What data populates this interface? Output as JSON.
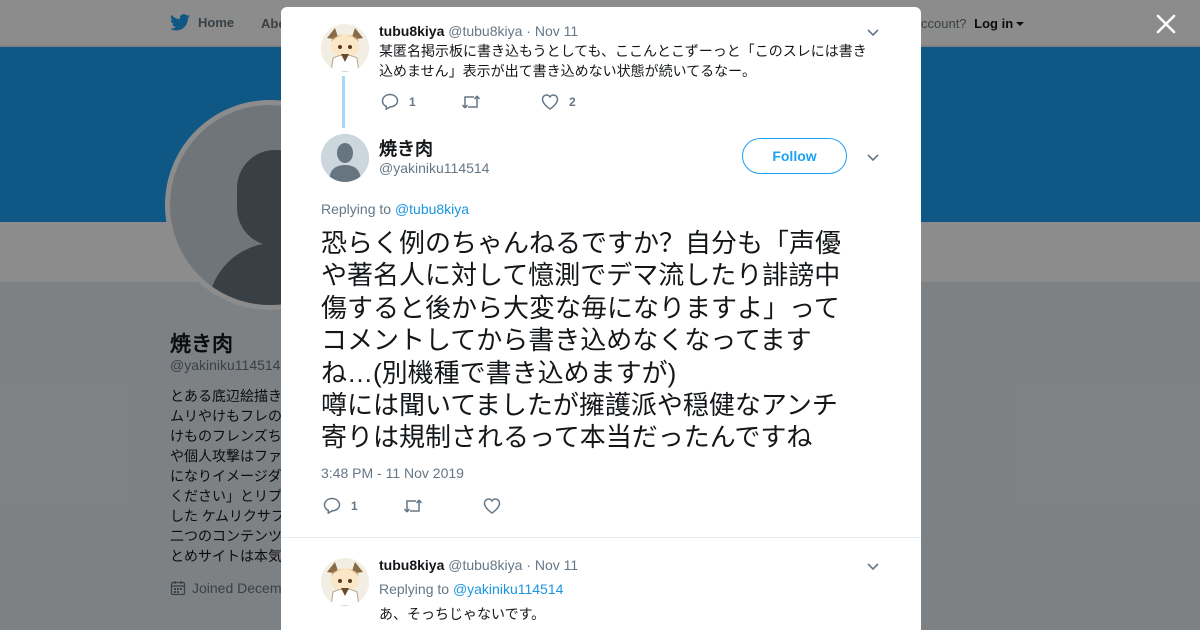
{
  "nav": {
    "home": "Home",
    "about": "Abo",
    "account_prompt": "ccount?",
    "login": "Log in"
  },
  "profile": {
    "name": "焼き肉",
    "handle": "@yakiniku114514",
    "bio_lines": [
      "とある底辺絵描き",
      "ムリやけもフレの",
      "けものフレンズち",
      "や個人攻撃はファ",
      "になりイメージダ",
      "ください」とリプ",
      "した ケムリクサフ",
      "二つのコンテンツ",
      "とめサイトは本気"
    ],
    "joined": "Joined Decem"
  },
  "modal": {
    "parent_tweet": {
      "display_name": "tubu8kiya",
      "handle": "@tubu8kiya",
      "date": "· Nov 11",
      "text_lines": [
        "某匿名掲示板に書き込もうとしても、ここんとこずーっと「このスレには書き",
        "込めません」表示が出て書き込めない状態が続いてるなー。"
      ],
      "reply_count": "1",
      "like_count": "2"
    },
    "main_tweet": {
      "display_name": "焼き肉",
      "handle": "@yakiniku114514",
      "follow_label": "Follow",
      "replying_prefix": "Replying to",
      "replying_to": "@tubu8kiya",
      "text_lines": [
        "恐らく例のちゃんねるですか？自分も「声優",
        "や著名人に対して憶測でデマ流したり誹謗中",
        "傷すると後から大変な毎になりますよ」って",
        "コメントしてから書き込めなくなってます",
        "ね…(別機種で書き込めますが)",
        "噂には聞いてましたが擁護派や穏健なアンチ",
        "寄りは規制されるって本当だったんですね"
      ],
      "timestamp": "3:48 PM - 11 Nov 2019",
      "reply_count": "1"
    },
    "reply_tweet": {
      "display_name": "tubu8kiya",
      "handle": "@tubu8kiya",
      "date": "· Nov 11",
      "replying_prefix": "Replying to",
      "replying_to": "@yakiniku114514",
      "text_line": "あ、そっちじゃないです。"
    }
  },
  "colors": {
    "brand_blue": "#1da1f2",
    "link_blue": "#1b95e0",
    "thread_line": "#a4d9f9",
    "secondary_text": "#657786"
  }
}
